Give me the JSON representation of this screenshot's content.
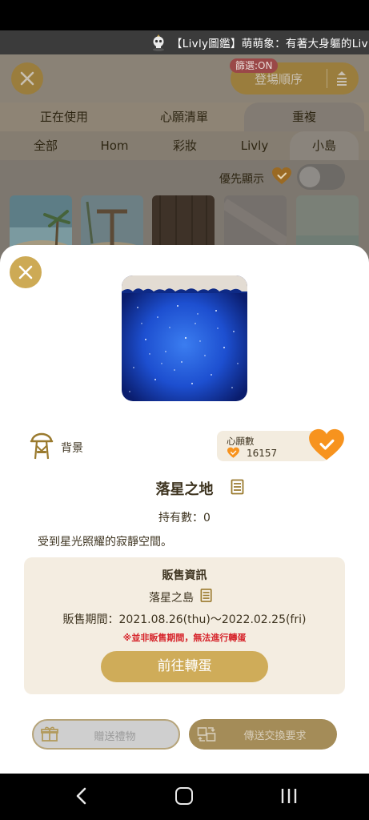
{
  "ticker": {
    "text": "【Livly圖鑑】萌萌象：有著大身軀的Livly"
  },
  "background_screen": {
    "sort_button_label": "登場順序",
    "filter_badge": "篩選:ON",
    "main_tabs": [
      "正在使用",
      "心願清單",
      "重複"
    ],
    "sub_tabs": [
      "全部",
      "Hom",
      "彩妝",
      "Livly",
      "小島"
    ],
    "priority_label": "優先顯示"
  },
  "dialog": {
    "category": "背景",
    "wishlist": {
      "label": "心願數",
      "count": "16157"
    },
    "item_name": "落星之地",
    "owned": "持有數：0",
    "description": "受到星光照耀的寂靜空間。",
    "sale_info": {
      "title": "販售資訊",
      "island": "落星之島",
      "period": "販售期間：2021.08.26(thu)～2022.02.25(fri)",
      "warning": "※並非販售期間，無法進行轉蛋",
      "gacha_button": "前往轉蛋"
    },
    "gift_button": "贈送禮物",
    "trade_button": "傳送交換要求"
  },
  "colors": {
    "accent_gold": "#cfac59",
    "heart_orange": "#f7931e",
    "warning_red": "#d6232a"
  },
  "icons": [
    "skull-icon",
    "close-icon",
    "sort-icon",
    "heart-icon",
    "swing-icon",
    "document-icon",
    "gift-icon",
    "trade-icon",
    "back-icon",
    "home-icon",
    "recents-icon"
  ]
}
